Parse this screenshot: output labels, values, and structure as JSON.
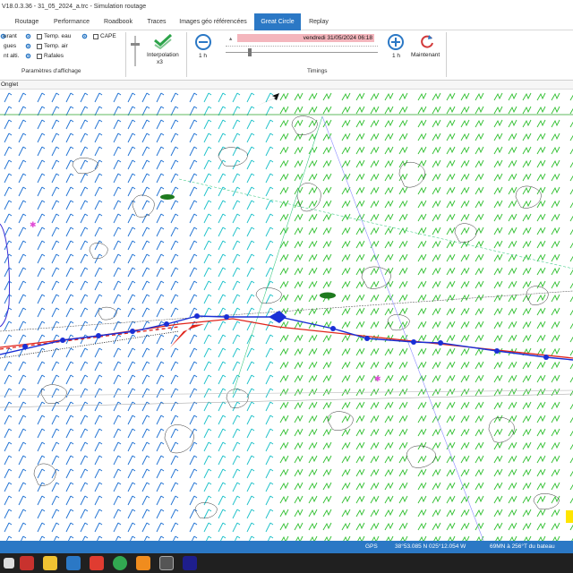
{
  "window": {
    "title": "V18.0.3.36 - 31_05_2024_a.trc - Simulation routage"
  },
  "menu": {
    "items": [
      {
        "label": "Routage",
        "active": false
      },
      {
        "label": "Performance",
        "active": false
      },
      {
        "label": "Roadbook",
        "active": false
      },
      {
        "label": "Traces",
        "active": false
      },
      {
        "label": "Images géo référencées",
        "active": false
      },
      {
        "label": "Great Circle",
        "active": true
      },
      {
        "label": "Replay",
        "active": false
      }
    ]
  },
  "display_params": {
    "rows": [
      {
        "left": "urant",
        "option": "Temp. eau"
      },
      {
        "left": "gues",
        "option": "Temp. air"
      },
      {
        "left": "nt alti.",
        "option": "Rafales"
      }
    ],
    "cape_label": "CAPE",
    "section_label": "Paramètres d'affichage"
  },
  "interpolation": {
    "label": "Interpolation",
    "value": "x3"
  },
  "timings": {
    "date": "vendredi 31/05/2024 06:18",
    "step_back": "1 h",
    "step_forward": "1 h",
    "now_label": "Maintenant",
    "section_label": "Timings"
  },
  "panel": {
    "tab_label": "Onglet"
  },
  "map": {
    "colors": {
      "wind_light": "#1b6fd2",
      "wind_medium": "#19c0c8",
      "wind_strong": "#2fbf2f",
      "isobar": "#333333",
      "route_blue": "#1a2fd6",
      "route_red": "#e0241b",
      "boat": "#e0241b"
    }
  },
  "status": {
    "gps": "GPS",
    "position": "38°53.085 N  025°12.054 W",
    "bearing": "69MN à 256°T du bateau"
  }
}
